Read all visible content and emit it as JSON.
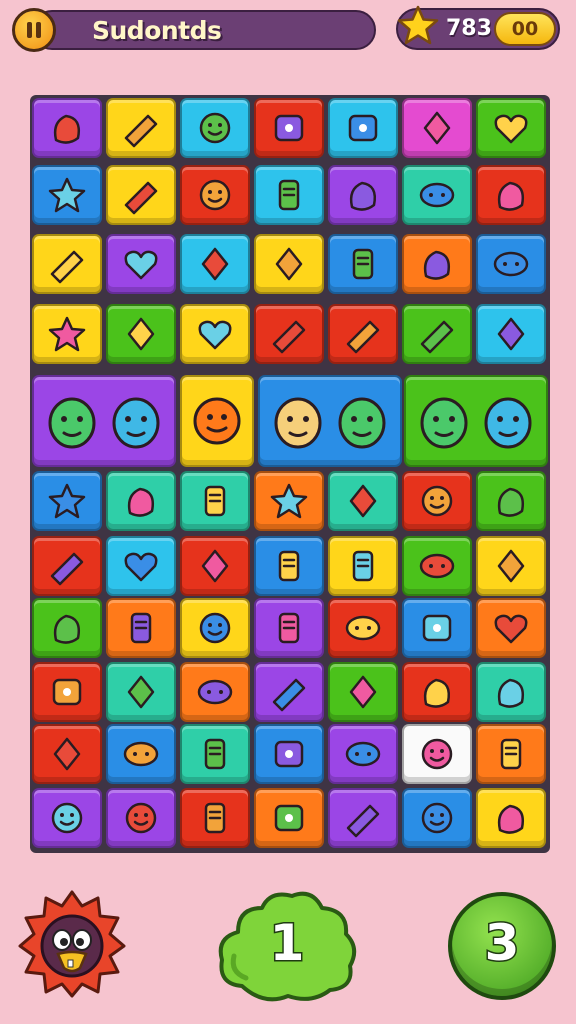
{
  "header": {
    "title": "Sudontds",
    "score": "783",
    "coins": "00"
  },
  "palette": {
    "purple": "#9b46e6",
    "yellow": "#ffd61a",
    "cyan": "#2ec3ec",
    "red": "#e6331c",
    "magenta": "#e44bd0",
    "green": "#4bc21b",
    "blue": "#2a8ee6",
    "orange": "#ff7a1a",
    "teal": "#2fcfa8",
    "white": "#fafafa"
  },
  "board": {
    "rows": [
      [
        "purple:candy-icon",
        "yellow:gift-box-icon",
        "cyan:slime-face-icon",
        "red:cupcake-icon",
        "cyan:wrapped-candy-icon",
        "magenta:cookie-jar-icon",
        "green:heart-box-icon"
      ],
      [
        "blue:star-icon",
        "yellow:popsicle-icon",
        "red:smiley-icon",
        "cyan:pencil-icon",
        "purple:fries-icon",
        "teal:gem-icon",
        "red:cross-icon"
      ],
      [
        "yellow:red-blob-icon",
        "purple:heart-icon",
        "cyan:tube-icon",
        "yellow:water-drop-icon",
        "blue:carrot-icon",
        "orange:radio-icon",
        "blue:magnifier-icon"
      ],
      [
        "yellow:splash-star-icon",
        "green:sofa-icon",
        "yellow:pink-heart-icon",
        "red:blue-box-icon",
        "red:lipstick-icon",
        "green:red-drop-icon",
        "cyan:bird-icon"
      ],
      [
        "purple:cat-face-icon|green-monster-icon",
        "yellow:orange-face-icon",
        "blue:octopus-icon|cat-animal-icon",
        "green:boy-face-icon|boy-face-icon"
      ],
      [
        "blue:small-star-icon",
        "teal:flame-icon",
        "teal:carrot-slice-icon",
        "orange:green-star-icon",
        "teal:ring-icon",
        "red:chick-icon",
        "green:green-cloud-icon"
      ],
      [
        "red:scissors-icon",
        "cyan:purple-heart-icon",
        "red:dice-icon",
        "blue:cheese-slice-icon",
        "yellow:flower-icon",
        "green:jar-icon",
        "yellow:soap-icon"
      ],
      [
        "green:cloud-icon",
        "orange:shield-icon",
        "yellow:purple-face-icon",
        "purple:basket-icon",
        "red:key-icon",
        "blue:crystal-icon",
        "orange:heart-pink-icon"
      ],
      [
        "red:bandage-icon",
        "teal:tube-green-icon",
        "orange:candy-bar-icon",
        "purple:cylinder-icon",
        "green:lips-icon",
        "red:bread-icon",
        "teal:brush-icon"
      ],
      [
        "red:book-icon",
        "blue:eye-icon",
        "teal:cheese-icon",
        "blue:map-pin-icon",
        "purple:ice-cream-icon",
        "white:sun-face-icon",
        "orange:eraser-icon"
      ],
      [
        "purple:mouth-face-icon",
        "purple:smile-face-icon",
        "red:marker-icon",
        "orange:notepad-icon",
        "purple:document-icon",
        "blue:red-face-icon",
        "yellow:pencil-pink-icon"
      ]
    ]
  },
  "footer": {
    "left_button_icon": "bird-character-icon",
    "middle_button_label": "1",
    "right_button_label": "3"
  }
}
